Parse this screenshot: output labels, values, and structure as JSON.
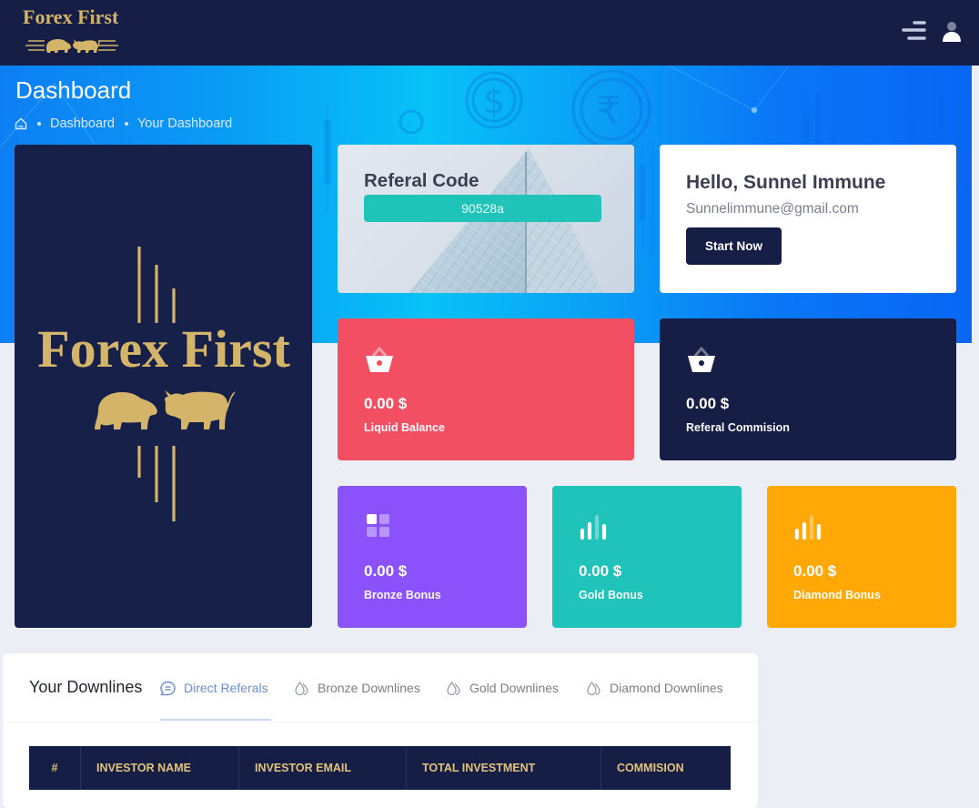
{
  "app": {
    "brand": "Forex First"
  },
  "header": {
    "menu_icon": "hamburger-menu-icon",
    "user_icon": "user-icon"
  },
  "page": {
    "title": "Dashboard",
    "breadcrumb": [
      "Dashboard",
      "Your Dashboard"
    ]
  },
  "logo_card": {
    "text": "Forex First"
  },
  "referral": {
    "title": "Referal Code",
    "code": "90528a"
  },
  "welcome": {
    "greeting": "Hello, Sunnel Immune",
    "email": "Sunnelimmune@gmail.com",
    "button": "Start Now"
  },
  "stats": [
    {
      "value": "0.00 $",
      "label": "Liquid Balance",
      "color": "#f34f63",
      "icon": "basket-icon"
    },
    {
      "value": "0.00 $",
      "label": "Referal Commision",
      "color": "#161e46",
      "icon": "basket-icon"
    },
    {
      "value": "0.00 $",
      "label": "Bronze Bonus",
      "color": "#8b51fb",
      "icon": "grid-icon"
    },
    {
      "value": "0.00 $",
      "label": "Gold Bonus",
      "color": "#1fc3b9",
      "icon": "bar-chart-icon"
    },
    {
      "value": "0.00 $",
      "label": "Diamond Bonus",
      "color": "#ffa806",
      "icon": "bar-chart-icon"
    }
  ],
  "downlines": {
    "title": "Your Downlines",
    "tabs": [
      {
        "label": "Direct Referals",
        "icon": "chat-icon",
        "active": true
      },
      {
        "label": "Bronze Downlines",
        "icon": "drops-icon",
        "active": false
      },
      {
        "label": "Gold Downlines",
        "icon": "drops-icon",
        "active": false
      },
      {
        "label": "Diamond Downlines",
        "icon": "drops-icon",
        "active": false
      }
    ],
    "table": {
      "columns": [
        "#",
        "INVESTOR NAME",
        "INVESTOR EMAIL",
        "TOTAL INVESTMENT",
        "COMMISION"
      ],
      "rows": []
    }
  },
  "colors": {
    "navy": "#171e45",
    "gold": "#d4b469",
    "accent_teal": "#1fc3b8"
  }
}
